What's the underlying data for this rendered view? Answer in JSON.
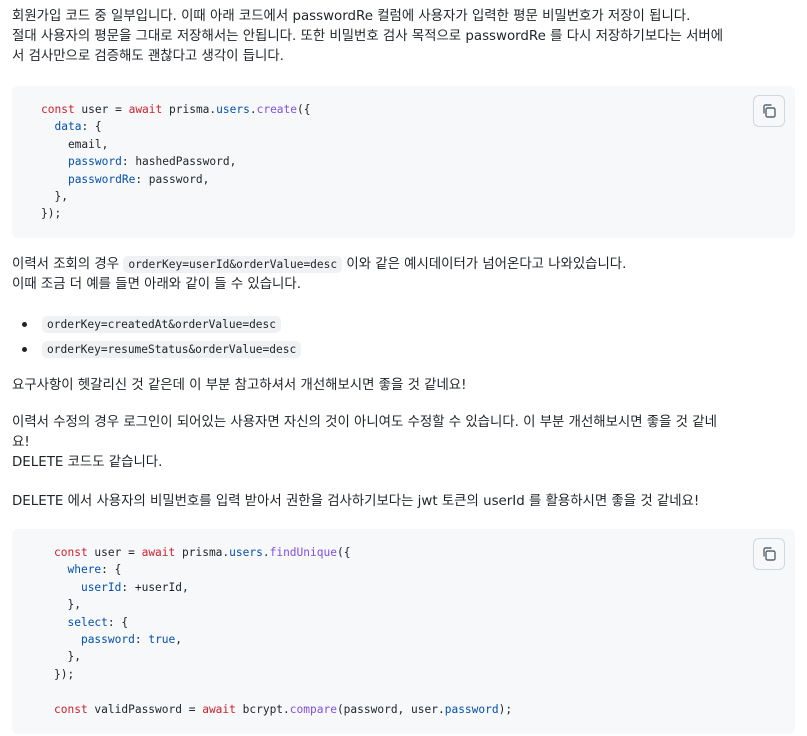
{
  "intro": {
    "line1": "회원가입 코드 중 일부입니다. 이때 아래 코드에서 passwordRe 컬럼에 사용자가 입력한 평문 비밀번호가 저장이 됩니다.",
    "line2": "절대 사용자의 평문을 그대로 저장해서는 안됩니다. 또한 비밀번호 검사 목적으로 passwordRe 를 다시 저장하기보다는 서버에",
    "line3": "서 검사만으로 검증해도 괜찮다고 생각이 듭니다."
  },
  "code1": {
    "l1_kw": "const",
    "l1_a": " user = ",
    "l1_await": "await",
    "l1_b": " prisma.",
    "l1_users": "users",
    "l1_dot": ".",
    "l1_fn": "create",
    "l1_c": "({",
    "l2_prop": "data",
    "l2_rest": ": {",
    "l3": "    email,",
    "l4_prop": "password",
    "l4_rest": ": hashedPassword,",
    "l5_prop": "passwordRe",
    "l5_rest": ": password,",
    "l6": "  },",
    "l7": "});"
  },
  "query": {
    "before": "이력서 조회의 경우 ",
    "code": "orderKey=userId&orderValue=desc",
    "after": " 이와 같은 예시데이터가 넘어온다고 나와있습니다.",
    "line2": "이때 조금 더 예를 들면 아래와 같이 들 수 있습니다."
  },
  "bullets": [
    "orderKey=createdAt&orderValue=desc",
    "orderKey=resumeStatus&orderValue=desc"
  ],
  "requirement": "요구사항이 헷갈리신 것 같은데 이 부분 참고하셔서 개선해보시면 좋을 것 같네요!",
  "edit": {
    "line1": "이력서 수정의 경우 로그인이 되어있는 사용자면 자신의 것이 아니여도 수정할 수 있습니다. 이 부분 개선해보시면 좋을 것 같네",
    "line2": "요!",
    "line3": "DELETE 코드도 같습니다."
  },
  "delete_note": "DELETE 에서 사용자의 비밀번호를 입력 받아서 권한을 검사하기보다는 jwt 토큰의 userId 를 활용하시면 좋을 것 같네요!",
  "code2": {
    "l1_kw": "const",
    "l1_a": " user = ",
    "l1_await": "await",
    "l1_b": " prisma.",
    "l1_users": "users",
    "l1_dot": ".",
    "l1_fn": "findUnique",
    "l1_c": "({",
    "l2_prop": "where",
    "l2_rest": ": {",
    "l3_prop": "userId",
    "l3_rest": ": +userId,",
    "l4": "  },",
    "l5_prop": "select",
    "l5_rest": ": {",
    "l6_prop": "password",
    "l6_colon": ": ",
    "l6_bool": "true",
    "l6_comma": ",",
    "l7": "  },",
    "l8": "});",
    "l10_kw": "const",
    "l10_a": " validPassword = ",
    "l10_await": "await",
    "l10_b": " bcrypt.",
    "l10_fn": "compare",
    "l10_c": "(password, user.",
    "l10_prop": "password",
    "l10_d": ");"
  },
  "icons": {
    "copy": "copy-icon"
  },
  "colors": {
    "keyword": "#cf222e",
    "function": "#8250df",
    "property": "#0550ae",
    "code_bg": "#f6f8fa"
  }
}
